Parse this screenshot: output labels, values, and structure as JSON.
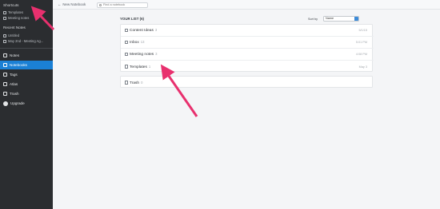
{
  "sidebar": {
    "shortcuts_title": "Shortcuts",
    "shortcuts": [
      {
        "label": "Templates"
      },
      {
        "label": "Meeting notes"
      }
    ],
    "recent_title": "Recent Notes",
    "recent": [
      {
        "label": "Untitled"
      },
      {
        "label": "May 2nd - Meeting Ag..."
      }
    ],
    "nav": [
      {
        "label": "Notes",
        "active": false
      },
      {
        "label": "Notebooks",
        "active": true
      },
      {
        "label": "Tags",
        "active": false
      },
      {
        "label": "Atlas",
        "active": false
      },
      {
        "label": "Trash",
        "active": false
      },
      {
        "label": "Upgrade",
        "active": false
      }
    ]
  },
  "topbar": {
    "new_notebook_label": "New Notebook",
    "search_placeholder": "Find a notebook"
  },
  "list": {
    "title": "YOUR LIST (6)",
    "sort_label": "Sort by",
    "sort_value": "Name",
    "notebooks": [
      {
        "name": "Content Ideas",
        "count": "3",
        "date": "5/1/15"
      },
      {
        "name": "Inbox",
        "count": "13",
        "date": "5:01 PM"
      },
      {
        "name": "Meeting notes",
        "count": "3",
        "date": "4:08 PM"
      },
      {
        "name": "Templates",
        "count": "1",
        "date": "May 3"
      }
    ],
    "trash": {
      "name": "Trash",
      "count": "0"
    }
  },
  "colors": {
    "sidebar_bg": "#2b2d30",
    "active_nav": "#1b80d5",
    "annotation_arrow": "#e8306e"
  }
}
